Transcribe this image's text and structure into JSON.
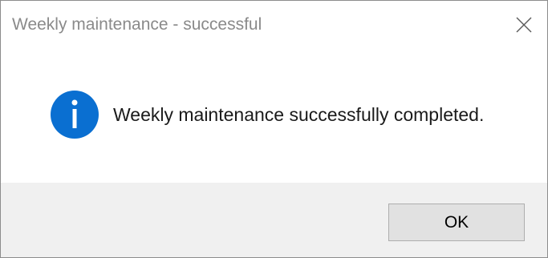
{
  "window": {
    "title": "Weekly maintenance - successful"
  },
  "message": {
    "text": "Weekly maintenance successfully completed.",
    "icon": "info-icon",
    "icon_color": "#0a6fd1"
  },
  "buttons": {
    "ok_label": "OK"
  },
  "colors": {
    "footer_bg": "#f0f0f0",
    "button_bg": "#e1e1e1",
    "button_border": "#adadad"
  }
}
